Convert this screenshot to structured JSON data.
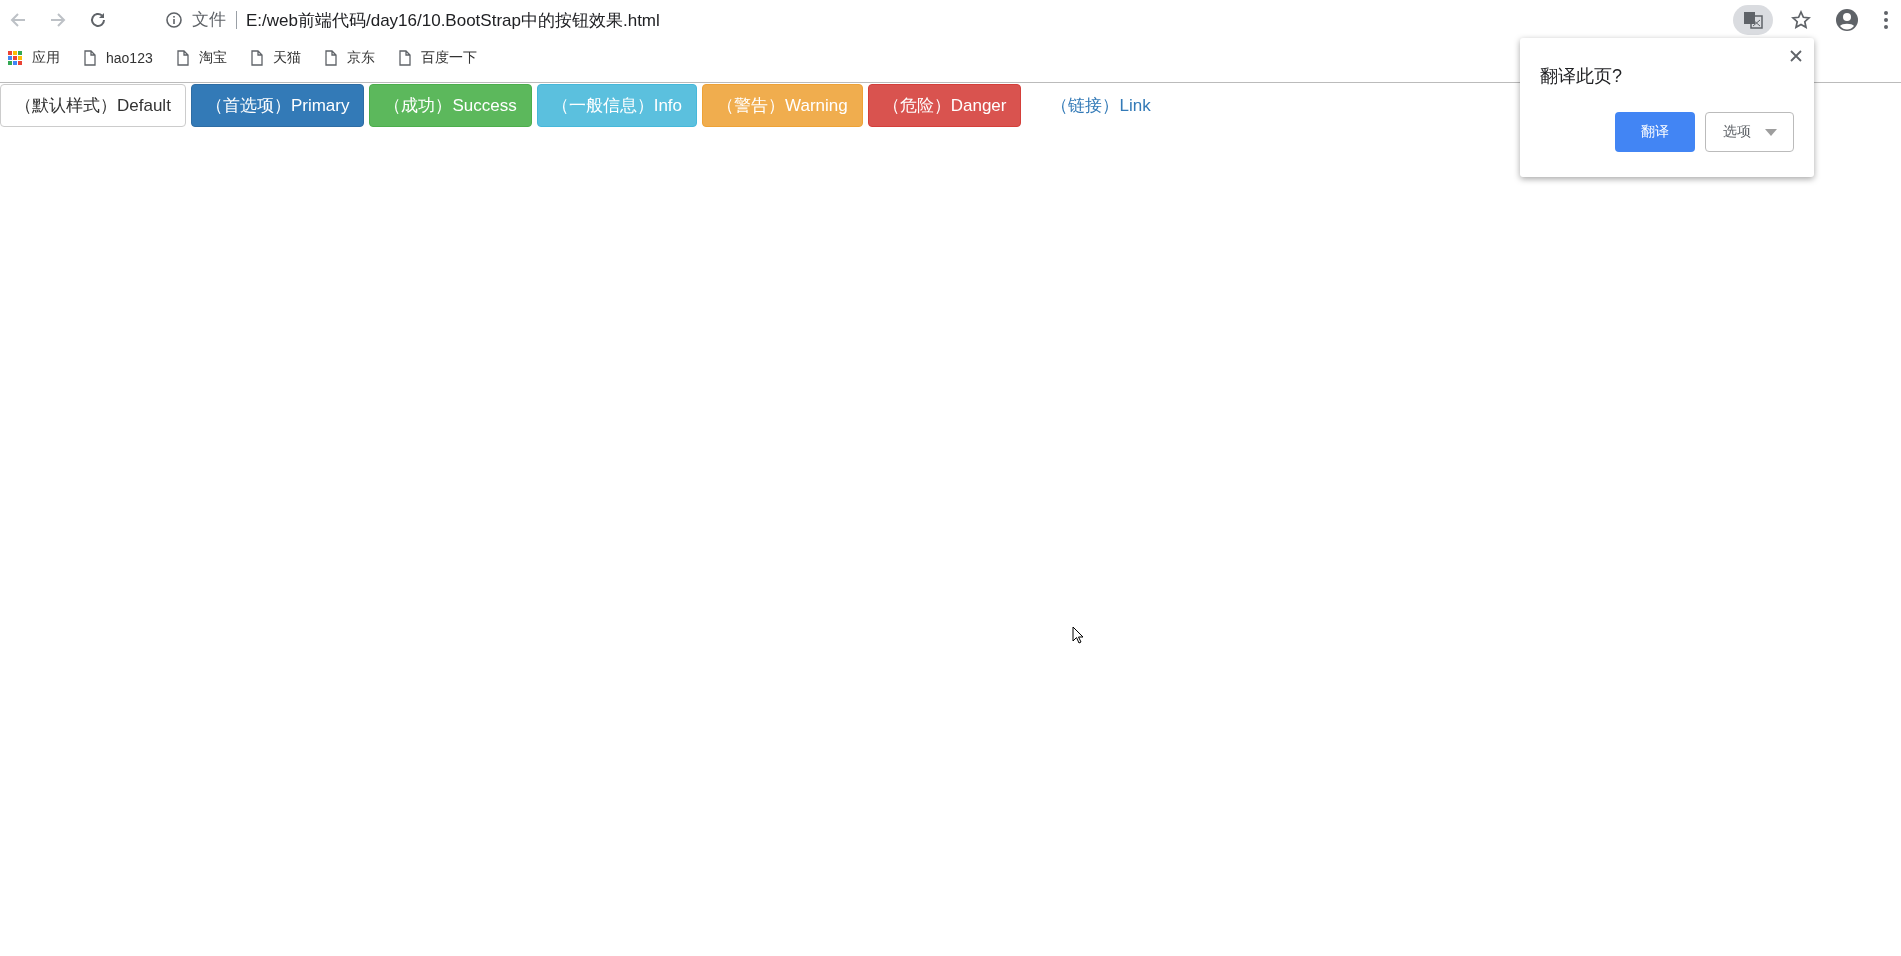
{
  "address_bar": {
    "security_label": "文件",
    "url": "E:/web前端代码/day16/10.BootStrap中的按钮效果.html"
  },
  "bookmarks": [
    {
      "label": "应用",
      "kind": "apps"
    },
    {
      "label": "hao123",
      "kind": "page"
    },
    {
      "label": "淘宝",
      "kind": "page"
    },
    {
      "label": "天猫",
      "kind": "page"
    },
    {
      "label": "京东",
      "kind": "page"
    },
    {
      "label": "百度一下",
      "kind": "page"
    }
  ],
  "page": {
    "buttons": [
      {
        "label": "（默认样式）Default",
        "kind": "default"
      },
      {
        "label": "（首选项）Primary",
        "kind": "primary"
      },
      {
        "label": "（成功）Success",
        "kind": "success"
      },
      {
        "label": "（一般信息）Info",
        "kind": "info"
      },
      {
        "label": "（警告）Warning",
        "kind": "warning"
      },
      {
        "label": "（危险）Danger",
        "kind": "danger"
      },
      {
        "label": "（链接）Link",
        "kind": "link"
      }
    ]
  },
  "translate_popup": {
    "title": "翻译此页?",
    "translate_button": "翻译",
    "options_button": "选项"
  }
}
